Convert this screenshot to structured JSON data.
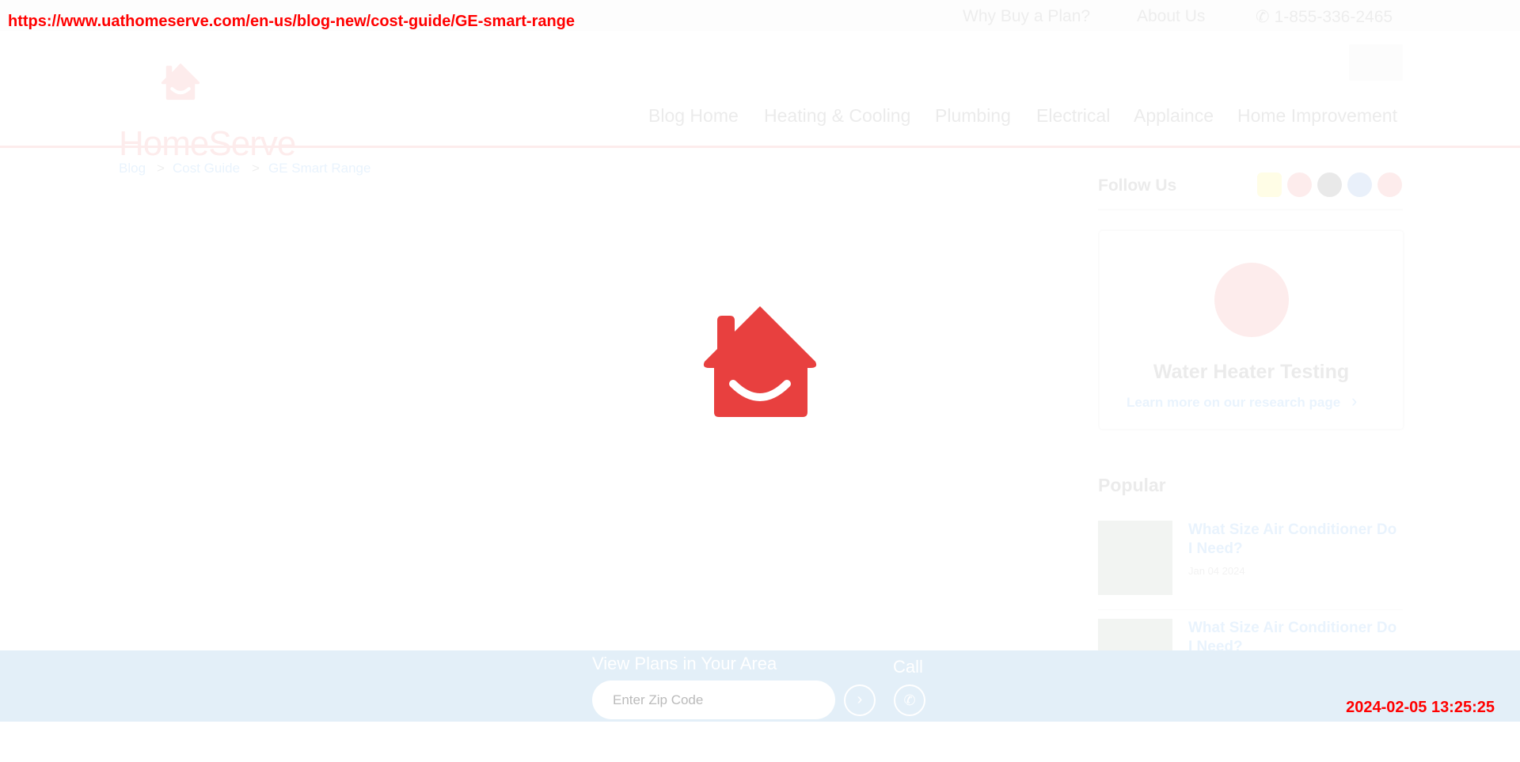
{
  "overlay": {
    "url": "https://www.uathomeserve.com/en-us/blog-new/cost-guide/GE-smart-range",
    "timestamp": "2024-02-05 13:25:25"
  },
  "topbar": {
    "why_buy": "Why Buy a Plan?",
    "about": "About Us",
    "phone": "1-855-336-2465"
  },
  "header": {
    "logo_text": "HomeServe",
    "nav": [
      "Blog Home",
      "Heating & Cooling",
      "Plumbing",
      "Electrical",
      "Applaince",
      "Home Improvement"
    ]
  },
  "breadcrumb": {
    "items": [
      "Blog",
      "Cost Guide",
      "GE Smart Range"
    ],
    "separator": ">"
  },
  "sidebar": {
    "follow_label": "Follow Us",
    "socials": [
      "snapchat-icon",
      "youtube-icon",
      "tiktok-icon",
      "linkedin-icon",
      "video-camera-icon"
    ],
    "card": {
      "title": "Water Heater Testing",
      "link": "Learn more on our research page"
    },
    "popular_label": "Popular",
    "popular": [
      {
        "title": "What Size Air Conditioner Do I Need?",
        "date": "Jan 04 2024"
      },
      {
        "title": "What Size Air Conditioner Do I Need?",
        "date": ""
      }
    ]
  },
  "bottom_bar": {
    "label": "View Plans in Your Area",
    "zip_placeholder": "Enter Zip Code",
    "call_label": "Call"
  },
  "colors": {
    "brand_red": "#e8403f",
    "link_blue": "#1e88e5",
    "bottom_bar_bg": "#e3eff8"
  }
}
